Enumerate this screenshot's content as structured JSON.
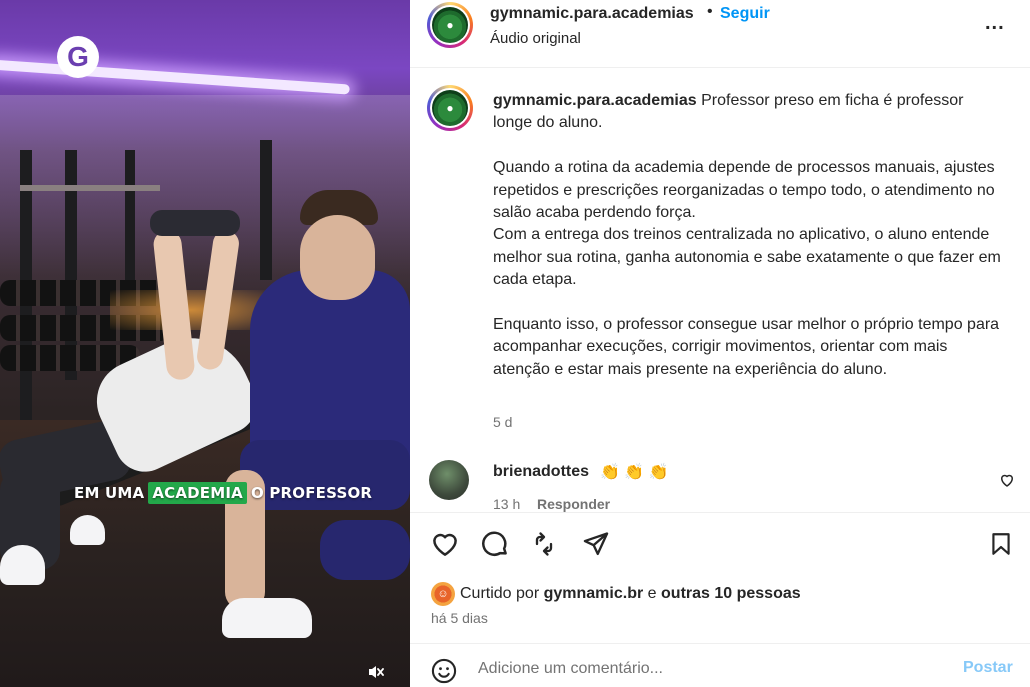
{
  "media": {
    "logo_letter": "G",
    "caption_prefix": "EM UMA",
    "caption_highlight": "ACADEMIA",
    "caption_suffix": "O PROFESSOR",
    "muted_icon": "speaker-muted-icon",
    "highlight_color": "#23a84a"
  },
  "header": {
    "username": "gymnamic.para.academias",
    "separator": "•",
    "follow_label": "Seguir",
    "audio_label": "Áudio original",
    "more_label": "..."
  },
  "post": {
    "username": "gymnamic.para.academias",
    "first_line": " Professor preso em ficha é professor longe do aluno.",
    "body": "\nQuando a rotina da academia depende de processos manuais, ajustes repetidos e prescrições reorganizadas o tempo todo, o atendimento no salão acaba perdendo força.\nCom a entrega dos treinos centralizada no aplicativo, o aluno entende melhor sua rotina, ganha autonomia e sabe exatamente o que fazer em cada etapa.\n\nEnquanto isso, o professor consegue usar melhor o próprio tempo para acompanhar execuções, corrigir movimentos, orientar com mais atenção e estar mais presente na experiência do aluno.",
    "time": "5 d"
  },
  "comment": {
    "username": "brienadottes",
    "emoji": "👏 👏 👏",
    "time": "13 h",
    "reply_label": "Responder"
  },
  "actions": {
    "liked_by_prefix": "Curtido por",
    "liked_by_user": "gymnamic.br",
    "liked_by_joiner": "e",
    "liked_by_others": "outras 10 pessoas",
    "date": "há 5 dias"
  },
  "add_comment": {
    "placeholder": "Adicione um comentário...",
    "post_label": "Postar"
  },
  "colors": {
    "accent": "#0095f6",
    "muted_text": "#737373",
    "post_button_disabled": "#87c9f8"
  }
}
